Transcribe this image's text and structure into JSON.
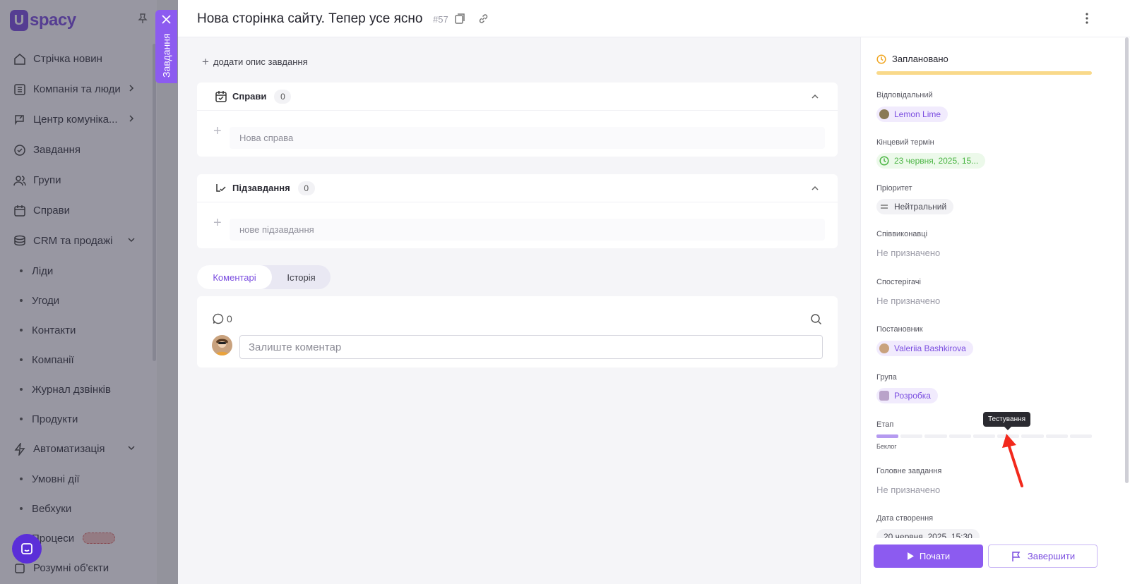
{
  "app": {
    "logo_letter": "U",
    "logo_text": "spacy"
  },
  "sidebar": {
    "items": [
      {
        "label": "Стрічка новин",
        "icon": "home-icon"
      },
      {
        "label": "Компанія та люди",
        "icon": "company-icon",
        "has_chevron": true
      },
      {
        "label": "Центр комуніка...",
        "icon": "communication-icon",
        "has_chevron": true
      },
      {
        "label": "Завдання",
        "icon": "tasks-icon"
      },
      {
        "label": "Групи",
        "icon": "groups-icon"
      },
      {
        "label": "Справи",
        "icon": "calendar-icon"
      },
      {
        "label": "CRM та продажі",
        "icon": "crm-icon",
        "expanded": true
      }
    ],
    "crm_sub": [
      "Ліди",
      "Угоди",
      "Контакти",
      "Компанії",
      "Журнал дзвінків",
      "Продукти"
    ],
    "automation": {
      "label": "Автоматизація",
      "icon": "lightning-icon"
    },
    "automation_sub": [
      "Умовні дії",
      "Вебхуки",
      "Процеси"
    ],
    "last_item": "Розумні об'єкти"
  },
  "side_tab": {
    "label": "Завдання"
  },
  "task": {
    "title": "Нова сторінка сайту. Тепер усе ясно",
    "number": "#57",
    "add_description": "додати опис завдання"
  },
  "todos": {
    "title": "Справи",
    "count": "0",
    "placeholder": "Нова справа"
  },
  "subtasks": {
    "title": "Підзавдання",
    "count": "0",
    "placeholder": "нове підзавдання"
  },
  "tabs": {
    "comments": "Коментарі",
    "history": "Історія"
  },
  "comments": {
    "count": "0",
    "placeholder": "Залиште коментар"
  },
  "details": {
    "status": "Заплановано",
    "status_color": "#f9d98a",
    "responsible_label": "Відповідальний",
    "responsible": "Lemon Lime",
    "deadline_label": "Кінцевий термін",
    "deadline": "23 червня, 2025, 15...",
    "priority_label": "Пріоритет",
    "priority": "Нейтральний",
    "coexecutors_label": "Співвиконавці",
    "coexecutors": "Не призначено",
    "observers_label": "Спостерігачі",
    "observers": "Не призначено",
    "creator_label": "Постановник",
    "creator": "Valeriia Bashkirova",
    "group_label": "Група",
    "group": "Розробка",
    "stage_label": "Етап",
    "stage_name": "Беклог",
    "stage_tooltip": "Тестування",
    "stages_total": 9,
    "stage_active_index": 0,
    "parent_label": "Головне завдання",
    "parent": "Не призначено",
    "created_label": "Дата створення",
    "created": "20 червня, 2025, 15:30"
  },
  "actions": {
    "start": "Почати",
    "finish": "Завершити"
  },
  "colors": {
    "accent": "#8c5bf0",
    "deadline_green": "#4bb544"
  }
}
